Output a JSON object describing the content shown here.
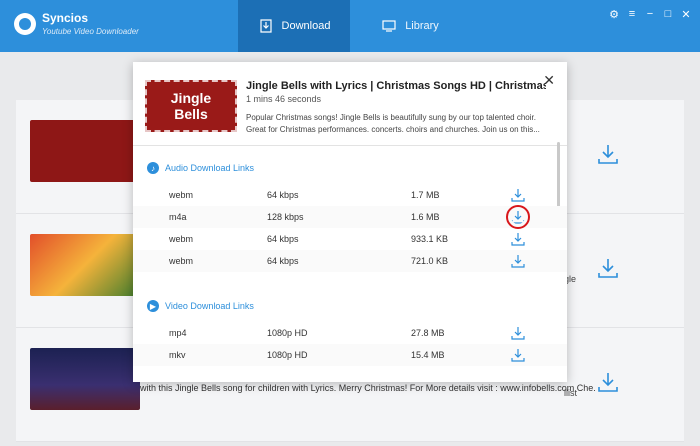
{
  "app": {
    "name": "Syncios",
    "subtitle": "Youtube Video Downloader"
  },
  "tabs": [
    {
      "label": "Download"
    },
    {
      "label": "Library"
    }
  ],
  "window_controls": [
    "⚙",
    "≡",
    "−",
    "□",
    "✕"
  ],
  "modal": {
    "thumb_words": [
      "Jingle",
      "Bells"
    ],
    "title": "Jingle Bells with Lyrics | Christmas Songs HD | Christmas Song...",
    "duration": "1 mins 46 seconds",
    "description": "Popular Christmas songs! Jingle Bells is beautifully sung by our top talented choir. Great for Christmas performances. concerts. choirs and churches. Join us on this...",
    "audio_section": "Audio Download Links",
    "video_section": "Video Download Links",
    "audio_rows": [
      {
        "format": "webm",
        "quality": "64 kbps",
        "size": "1.7 MB"
      },
      {
        "format": "m4a",
        "quality": "128 kbps",
        "size": "1.6 MB"
      },
      {
        "format": "webm",
        "quality": "64 kbps",
        "size": "933.1 KB"
      },
      {
        "format": "webm",
        "quality": "64 kbps",
        "size": "721.0 KB"
      }
    ],
    "video_rows": [
      {
        "format": "mp4",
        "quality": "1080p HD",
        "size": "27.8 MB"
      },
      {
        "format": "mkv",
        "quality": "1080p HD",
        "size": "15.4 MB"
      }
    ]
  },
  "background": {
    "text_fragment_1": "gle",
    "text_fragment_2": "llist",
    "bottom_text": "with this Jingle Bells song for children with Lyrics. Merry Christmas! For More details visit : www.infobells.com Che..."
  },
  "colors": {
    "brand": "#2d8fdb",
    "highlight": "#d8171b"
  }
}
